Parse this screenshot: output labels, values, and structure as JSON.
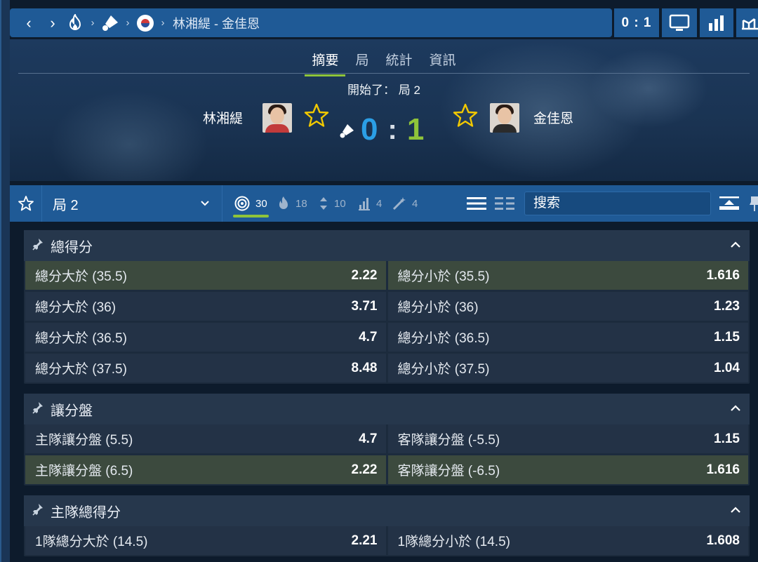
{
  "topbar": {
    "back": "‹",
    "forward": "›",
    "match_title": "林湘緹 - 金佳恩",
    "score_button": "0 : 1",
    "icons": [
      "fire-icon",
      "shuttlecock-icon",
      "korea-flag-icon",
      "tv-icon",
      "stats-icon",
      "bracket-icon"
    ]
  },
  "hero": {
    "tabs": [
      "摘要",
      "局",
      "統計",
      "資訊"
    ],
    "active_tab": "摘要",
    "status": "開始了： 局 2",
    "home_name": "林湘緹",
    "away_name": "金佳恩",
    "home_score": "0",
    "away_score": "1",
    "colon": ":"
  },
  "filterbar": {
    "period": "局 2",
    "filters": [
      {
        "icon": "target-icon",
        "count": "30"
      },
      {
        "icon": "fire-icon",
        "count": "18"
      },
      {
        "icon": "updown-icon",
        "count": "10"
      },
      {
        "icon": "ladder-icon",
        "count": "4"
      },
      {
        "icon": "wand-icon",
        "count": "4"
      }
    ],
    "search_placeholder": "搜索"
  },
  "markets": [
    {
      "title": "總得分",
      "rows": [
        [
          {
            "label": "總分大於 (35.5)",
            "odds": "2.22",
            "hl": true
          },
          {
            "label": "總分小於 (35.5)",
            "odds": "1.616",
            "hl": true
          }
        ],
        [
          {
            "label": "總分大於 (36)",
            "odds": "3.71",
            "hl": false
          },
          {
            "label": "總分小於 (36)",
            "odds": "1.23",
            "hl": false
          }
        ],
        [
          {
            "label": "總分大於 (36.5)",
            "odds": "4.7",
            "hl": false
          },
          {
            "label": "總分小於 (36.5)",
            "odds": "1.15",
            "hl": false
          }
        ],
        [
          {
            "label": "總分大於 (37.5)",
            "odds": "8.48",
            "hl": false
          },
          {
            "label": "總分小於 (37.5)",
            "odds": "1.04",
            "hl": false
          }
        ]
      ]
    },
    {
      "title": "讓分盤",
      "rows": [
        [
          {
            "label": "主隊讓分盤 (5.5)",
            "odds": "4.7",
            "hl": false
          },
          {
            "label": "客隊讓分盤 (-5.5)",
            "odds": "1.15",
            "hl": false
          }
        ],
        [
          {
            "label": "主隊讓分盤 (6.5)",
            "odds": "2.22",
            "hl": true
          },
          {
            "label": "客隊讓分盤 (-6.5)",
            "odds": "1.616",
            "hl": true
          }
        ]
      ]
    },
    {
      "title": "主隊總得分",
      "rows": [
        [
          {
            "label": "1隊總分大於 (14.5)",
            "odds": "2.21",
            "hl": false
          },
          {
            "label": "1隊總分小於 (14.5)",
            "odds": "1.608",
            "hl": false
          }
        ]
      ]
    }
  ],
  "colors": {
    "accent_blue": "#1f5a96",
    "home_score": "#2b9fe6",
    "away_score": "#8fc43a",
    "star": "#f2c900",
    "highlight_row": "#3c4a3e"
  }
}
